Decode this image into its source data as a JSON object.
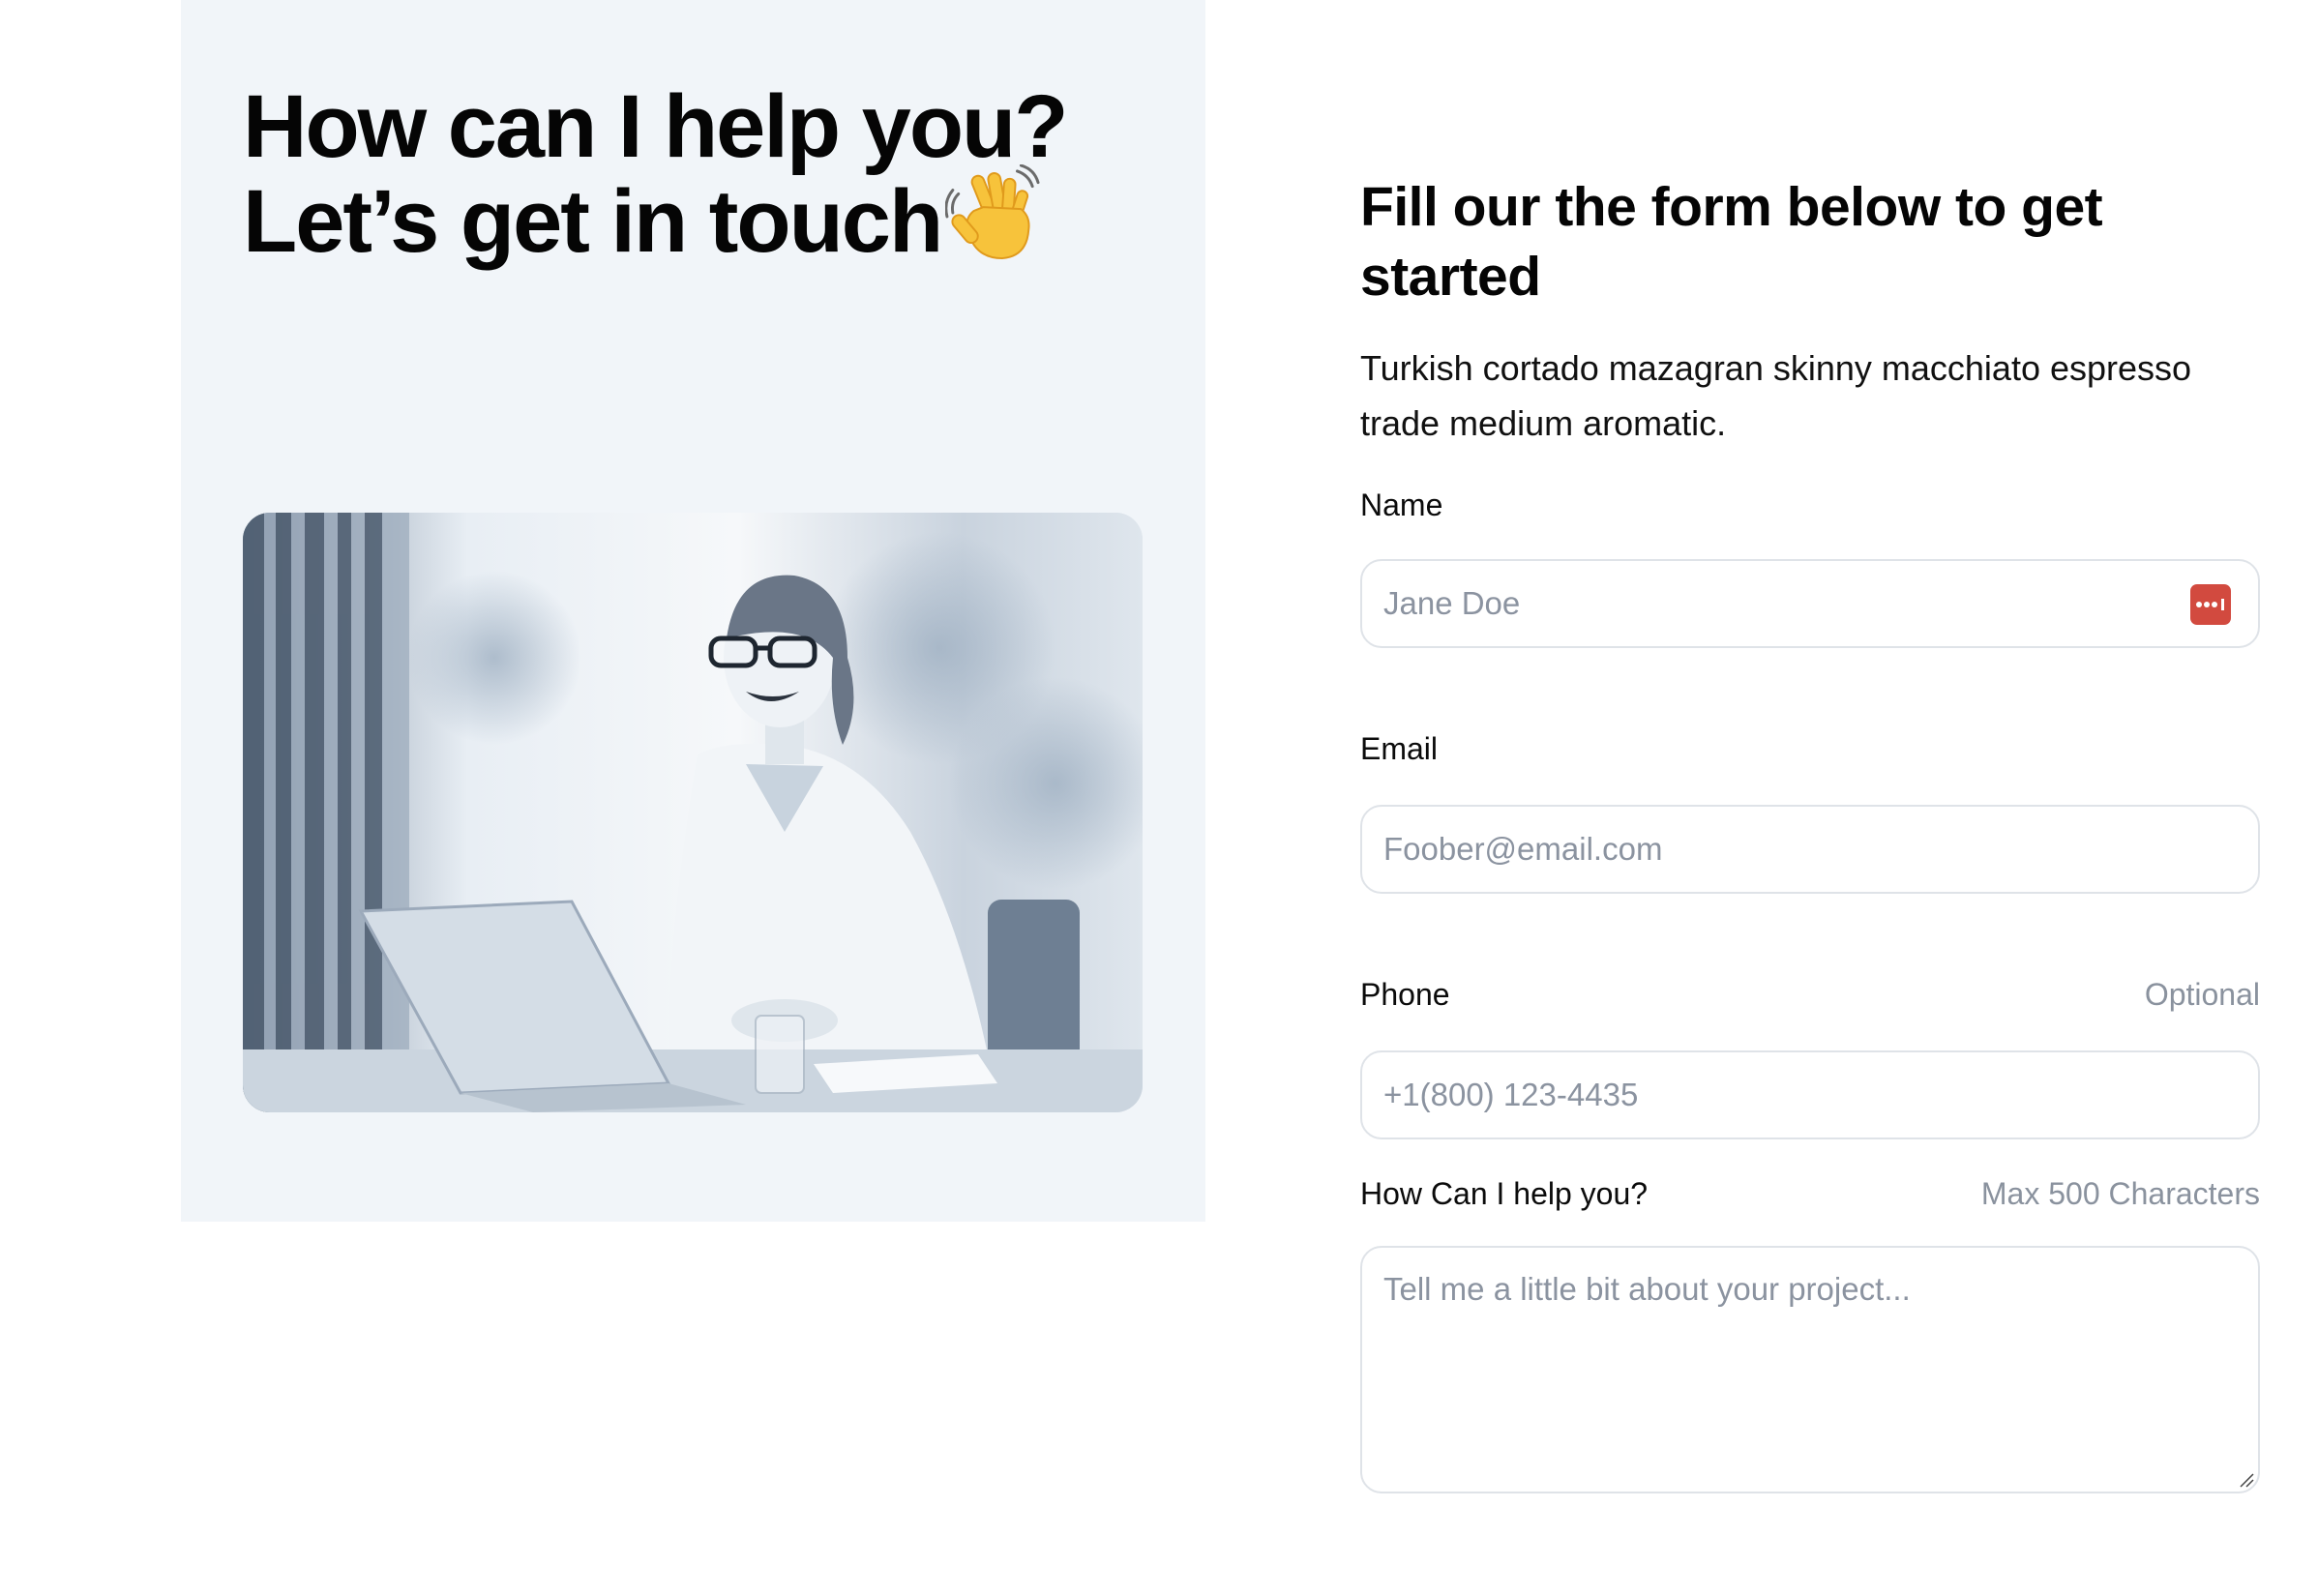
{
  "hero": {
    "line1": "How can I help you?",
    "line2": "Let’s get in touch"
  },
  "icons": {
    "wave": "waving-hand-emoji",
    "password_manager": "password-manager-icon",
    "resize": "resize-handle-icon",
    "photo": "woman-at-laptop-photo"
  },
  "form": {
    "title": "Fill our the form below to get started",
    "description": "Turkish cortado mazagran skinny macchiato espresso trade medium aromatic.",
    "name": {
      "label": "Name",
      "placeholder": "Jane Doe"
    },
    "email": {
      "label": "Email",
      "placeholder": "Foober@email.com"
    },
    "phone": {
      "label": "Phone",
      "hint": "Optional",
      "placeholder": "+1(800) 123-4435"
    },
    "message": {
      "label": "How Can I help you?",
      "hint": "Max 500 Characters",
      "placeholder": "Tell me a little bit about your project..."
    }
  },
  "colors": {
    "panel_bg": "#f1f5f9",
    "border": "#dfe3e8",
    "placeholder": "#8b93a0",
    "password_icon": "#d24a3f"
  }
}
